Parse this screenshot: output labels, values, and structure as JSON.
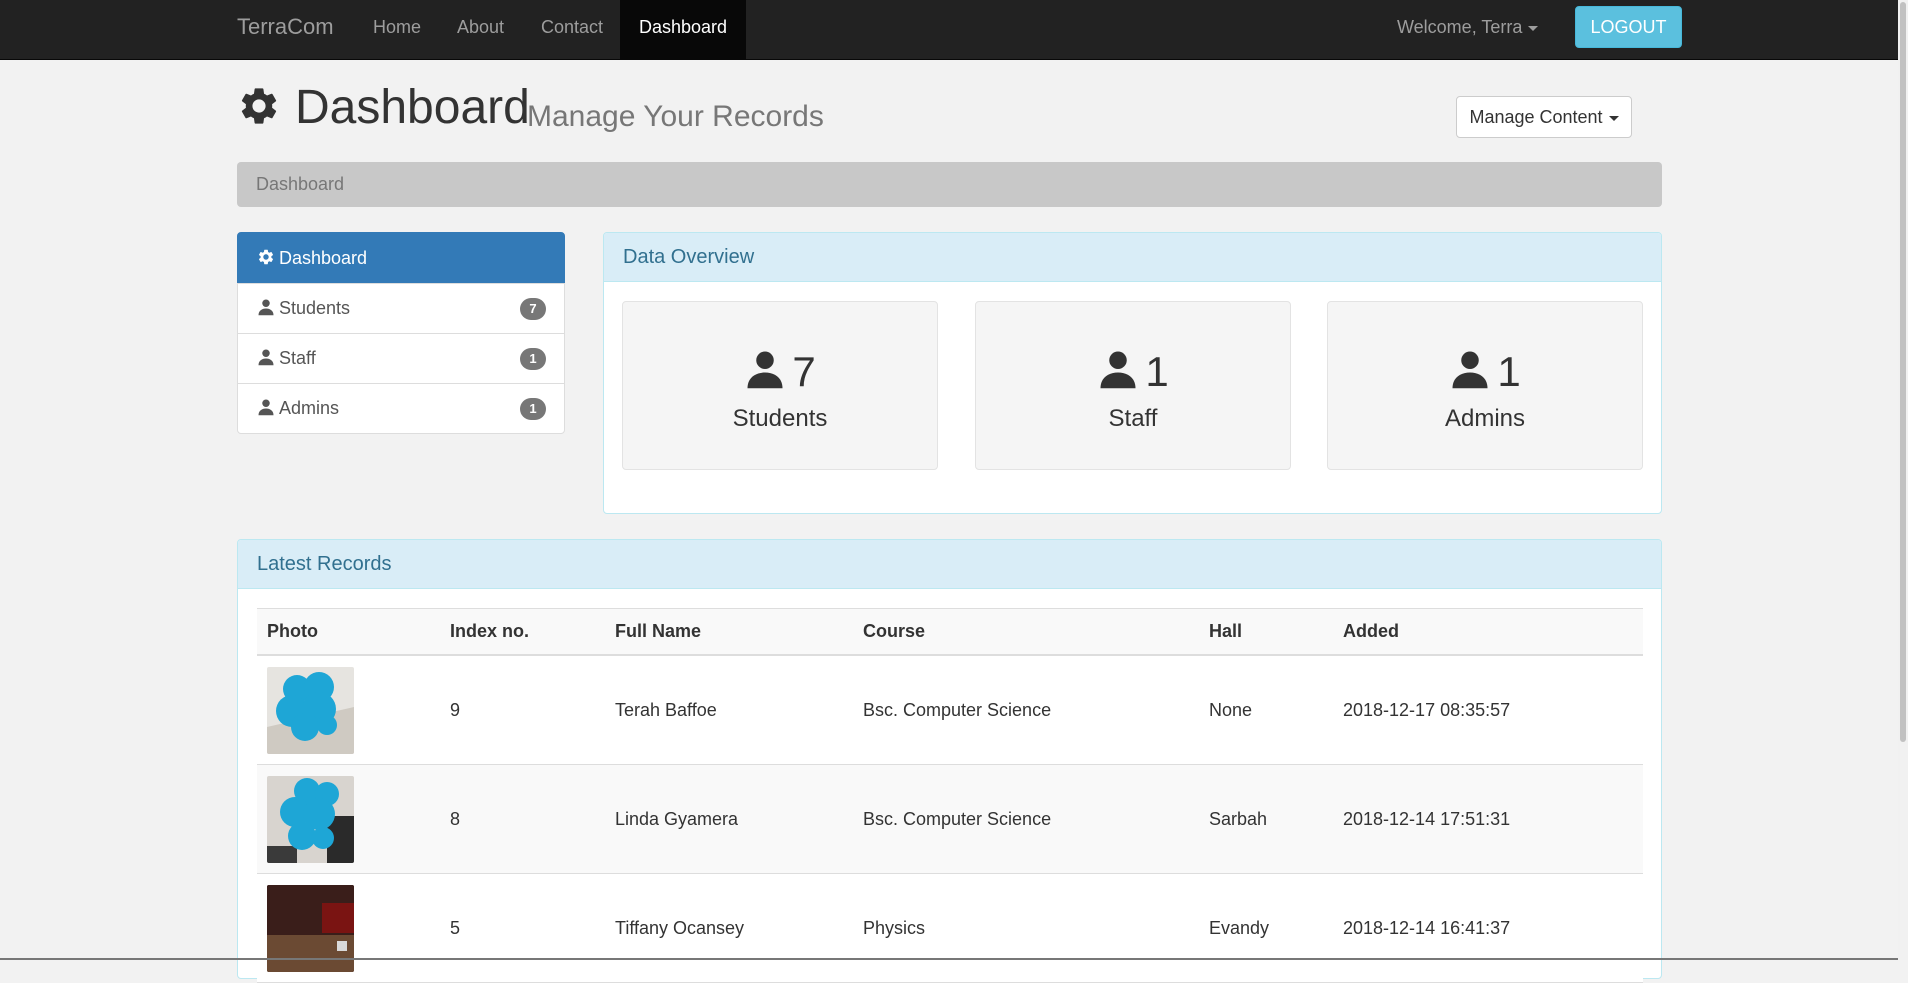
{
  "nav": {
    "brand": "TerraCom",
    "links": [
      "Home",
      "About",
      "Contact",
      "Dashboard"
    ],
    "welcome": "Welcome, Terra",
    "logout": "LOGOUT"
  },
  "header": {
    "title": "Dashboard",
    "subtitle": "Manage Your Records",
    "manage_button": "Manage Content"
  },
  "breadcrumb": "Dashboard",
  "sidebar": {
    "items": [
      {
        "label": "Dashboard",
        "icon": "gear-icon"
      },
      {
        "label": "Students",
        "badge": "7",
        "icon": "user-icon"
      },
      {
        "label": "Staff",
        "badge": "1",
        "icon": "user-icon"
      },
      {
        "label": "Admins",
        "badge": "1",
        "icon": "user-icon"
      }
    ]
  },
  "overview": {
    "title": "Data Overview",
    "cards": [
      {
        "count": "7",
        "label": "Students",
        "icon": "user-icon"
      },
      {
        "count": "1",
        "label": "Staff",
        "icon": "user-icon"
      },
      {
        "count": "1",
        "label": "Admins",
        "icon": "user-icon"
      }
    ]
  },
  "records": {
    "title": "Latest Records",
    "columns": [
      "Photo",
      "Index no.",
      "Full Name",
      "Course",
      "Hall",
      "Added"
    ],
    "rows": [
      {
        "index": "9",
        "name": "Terah Baffoe",
        "course": "Bsc. Computer Science",
        "hall": "None",
        "added": "2018-12-17 08:35:57"
      },
      {
        "index": "8",
        "name": "Linda Gyamera",
        "course": "Bsc. Computer Science",
        "hall": "Sarbah",
        "added": "2018-12-14 17:51:31"
      },
      {
        "index": "5",
        "name": "Tiffany Ocansey",
        "course": "Physics",
        "hall": "Evandy",
        "added": "2018-12-14 16:41:37"
      }
    ]
  },
  "colors": {
    "navbar": "#222222",
    "primary": "#337ab7",
    "info": "#5bc0de",
    "panel_heading": "#d9edf7"
  }
}
